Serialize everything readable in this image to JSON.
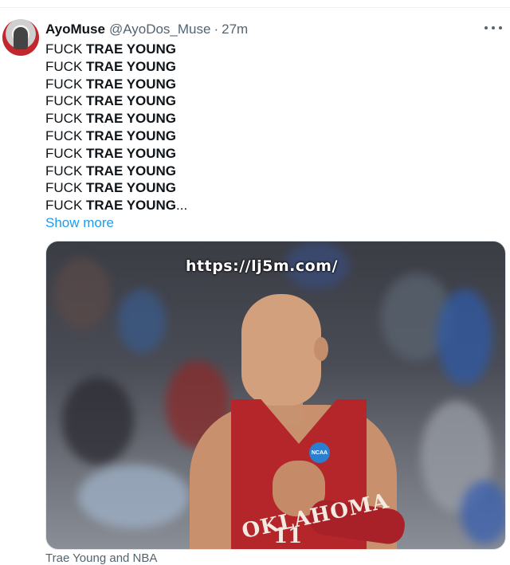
{
  "tweet": {
    "display_name": "AyoMuse",
    "handle": "@AyoDos_Muse",
    "separator": "·",
    "time": "27m",
    "lines": [
      {
        "prefix": "FUCK ",
        "bold": "TRAE YOUNG",
        "suffix": ""
      },
      {
        "prefix": "FUCK ",
        "bold": "TRAE YOUNG",
        "suffix": ""
      },
      {
        "prefix": "FUCK ",
        "bold": "TRAE YOUNG",
        "suffix": ""
      },
      {
        "prefix": "FUCK ",
        "bold": "TRAE YOUNG",
        "suffix": ""
      },
      {
        "prefix": "FUCK ",
        "bold": "TRAE YOUNG",
        "suffix": ""
      },
      {
        "prefix": "FUCK ",
        "bold": "TRAE YOUNG",
        "suffix": ""
      },
      {
        "prefix": "FUCK ",
        "bold": "TRAE YOUNG",
        "suffix": ""
      },
      {
        "prefix": "FUCK ",
        "bold": "TRAE YOUNG",
        "suffix": ""
      },
      {
        "prefix": "FUCK ",
        "bold": "TRAE YOUNG",
        "suffix": ""
      },
      {
        "prefix": "FUCK ",
        "bold": "TRAE YOUNG",
        "suffix": "..."
      }
    ],
    "show_more": "Show more",
    "media": {
      "watermark": "https://lj5m.com/",
      "jersey_text": "OKLAHOMA",
      "jersey_number": "11",
      "badge": "NCAA"
    },
    "caption": "Trae Young and NBA"
  },
  "colors": {
    "link": "#1d9bf0",
    "secondary_text": "#536471",
    "primary_text": "#0f1419",
    "jersey": "#b5262b"
  },
  "icons": {
    "more": "more-horizontal-icon"
  }
}
